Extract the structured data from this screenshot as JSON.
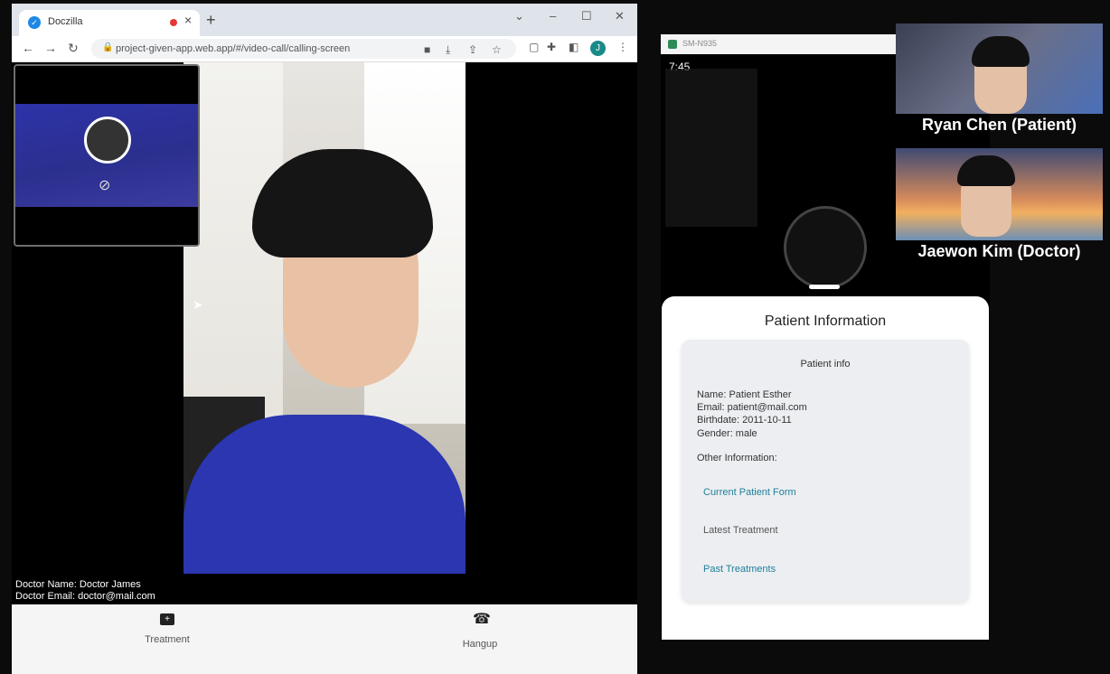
{
  "browser": {
    "tab_title": "Doczilla",
    "url": "project-given-app.web.app/#/video-call/calling-screen",
    "profile_initial": "J",
    "favicon_glyph": "✓",
    "new_tab_glyph": "+",
    "close_glyph": "×",
    "window_controls": [
      "⌄",
      "–",
      "☐",
      "✕"
    ],
    "nav_icons": [
      "←",
      "→",
      "↻"
    ],
    "toolbar_icons": [
      "camera-icon",
      "install-icon",
      "share-icon",
      "bookmark-star-icon",
      "extension-icon",
      "puzzle-icon",
      "sidepanel-icon",
      "kebab-menu-icon"
    ]
  },
  "call": {
    "doctor_name": "Doctor Name: Doctor James",
    "doctor_email": "Doctor Email: doctor@mail.com",
    "treatment_label": "Treatment",
    "hangup_label": "Hangup"
  },
  "phone": {
    "window_title": "SM-N935",
    "status_time": "7:45",
    "sheet_title": "Patient Information",
    "card_title": "Patient info",
    "name": "Name: Patient Esther",
    "email": "Email: patient@mail.com",
    "birthdate": "Birthdate: 2011-10-11",
    "gender": "Gender: male",
    "other_info": "Other Information:",
    "links": [
      "Current Patient Form",
      "Latest Treatment",
      "Past Treatments"
    ],
    "link_colors": [
      "#1f7f9a",
      "#555555",
      "#1f7f9a"
    ]
  },
  "participants": {
    "patient": "Ryan Chen (Patient)",
    "doctor": "Jaewon Kim (Doctor)"
  }
}
